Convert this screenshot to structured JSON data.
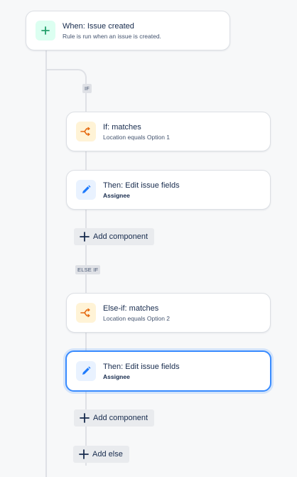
{
  "trigger": {
    "title": "When: Issue created",
    "subtitle": "Rule is run when an issue is created.",
    "icon": "plus-icon"
  },
  "branches": {
    "if_label": "IF",
    "else_if_label": "ELSE IF"
  },
  "if_condition": {
    "title": "If: matches",
    "subtitle": "Location equals Option 1",
    "icon": "branch-icon"
  },
  "if_action": {
    "title": "Then: Edit issue fields",
    "subtitle": "Assignee",
    "icon": "pencil-icon"
  },
  "add_component_1": {
    "label": "Add component"
  },
  "else_if_condition": {
    "title": "Else-if: matches",
    "subtitle": "Location equals Option 2",
    "icon": "branch-icon"
  },
  "else_if_action": {
    "title": "Then: Edit issue fields",
    "subtitle": "Assignee",
    "icon": "pencil-icon",
    "selected": true
  },
  "add_component_2": {
    "label": "Add component"
  },
  "add_else": {
    "label": "Add else"
  },
  "colors": {
    "trigger_icon": "#22a06b",
    "condition_icon": "#e56910",
    "action_icon": "#1d7afc",
    "selected_border": "#388bff"
  }
}
